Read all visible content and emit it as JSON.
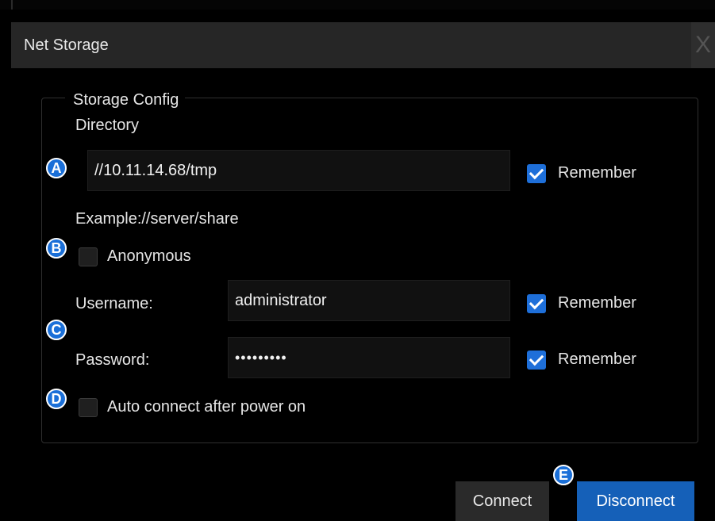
{
  "dialog": {
    "title": "Net Storage",
    "close_label": "X"
  },
  "storage_config": {
    "legend": "Storage Config",
    "directory_label": "Directory",
    "directory_value": "//10.11.14.68/tmp",
    "directory_remember": "Remember",
    "example_text": "Example://server/share",
    "anonymous_label": "Anonymous",
    "username_label": "Username:",
    "username_value": "administrator",
    "username_remember": "Remember",
    "password_label": "Password:",
    "password_value": "•••••••••",
    "password_remember": "Remember",
    "auto_connect_label": "Auto connect after power on"
  },
  "checks": {
    "directory_remember": true,
    "anonymous": false,
    "username_remember": true,
    "password_remember": true,
    "auto_connect": false
  },
  "buttons": {
    "connect": "Connect",
    "disconnect": "Disconnect"
  },
  "badges": {
    "a": "A",
    "b": "B",
    "c": "C",
    "d": "D",
    "e": "E"
  },
  "colors": {
    "accent": "#1e6fd9",
    "disconnect_bg": "#1560b8",
    "titlebar_bg": "#262626"
  }
}
